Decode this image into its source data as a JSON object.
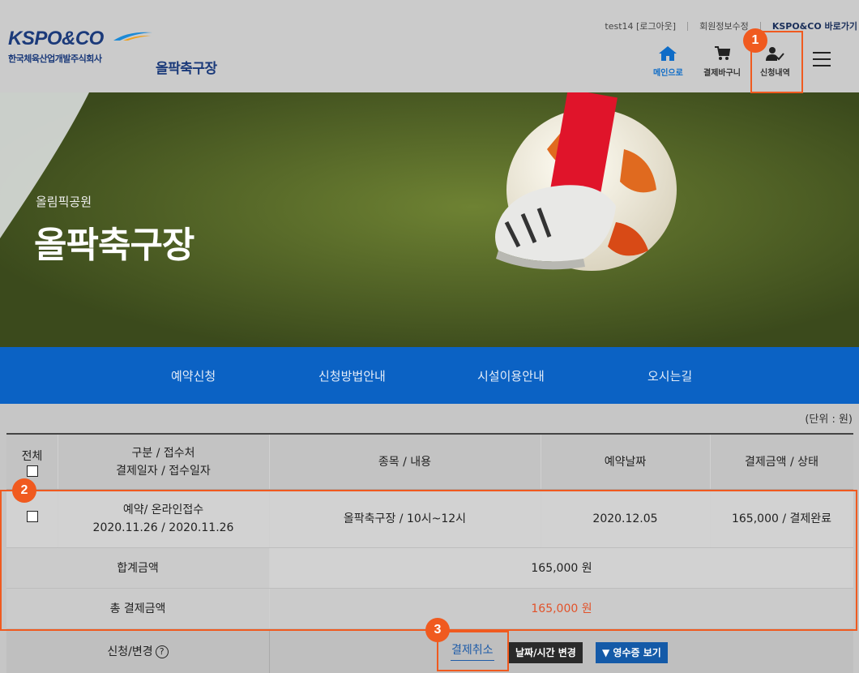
{
  "topnav": {
    "user": "test14 [로그아웃]",
    "member_info": "회원정보수정",
    "kspo_link": "KSPO&CO 바로가기"
  },
  "logo": {
    "word": "KSPO&CO",
    "subtitle": "한국체육산업개발주식회사"
  },
  "site_title": "올팍축구장",
  "header_icons": [
    {
      "name": "home-icon",
      "label": "메인으로"
    },
    {
      "name": "cart-icon",
      "label": "결제바구니"
    },
    {
      "name": "user-check-icon",
      "label": "신청내역"
    }
  ],
  "hero": {
    "subtitle": "올림픽공원",
    "title": "올팍축구장"
  },
  "main_nav": [
    "예약신청",
    "신청방법안내",
    "시설이용안내",
    "오시는길"
  ],
  "unit_note": "(단위 : 원)",
  "table": {
    "headers": {
      "all": "전체",
      "category_line1": "구분 / 접수처",
      "category_line2": "결제일자 / 접수일자",
      "item": "종목 / 내용",
      "date": "예약날짜",
      "amount": "결제금액 / 상태"
    },
    "rows": [
      {
        "category_line1": "예약/ 온라인접수",
        "category_line2": "2020.11.26 / 2020.11.26",
        "item": "올팍축구장 / 10시~12시",
        "date": "2020.12.05",
        "amount": "165,000 / 결제완료"
      }
    ],
    "sum_label": "합계금액",
    "sum_value": "165,000 원",
    "total_label": "총 결제금액",
    "total_value": "165,000 원",
    "action_label": "신청/변경",
    "help_glyph": "?",
    "buttons": {
      "cancel": "결제취소",
      "change_date": "날짜/시간 변경",
      "receipt": "▼ 영수증 보기"
    }
  },
  "annotations": [
    "1",
    "2",
    "3"
  ],
  "colors": {
    "highlight": "#f05a1f",
    "nav_blue": "#0b62c4",
    "brand_navy": "#1b3a7a",
    "total_red": "#e2522a"
  }
}
